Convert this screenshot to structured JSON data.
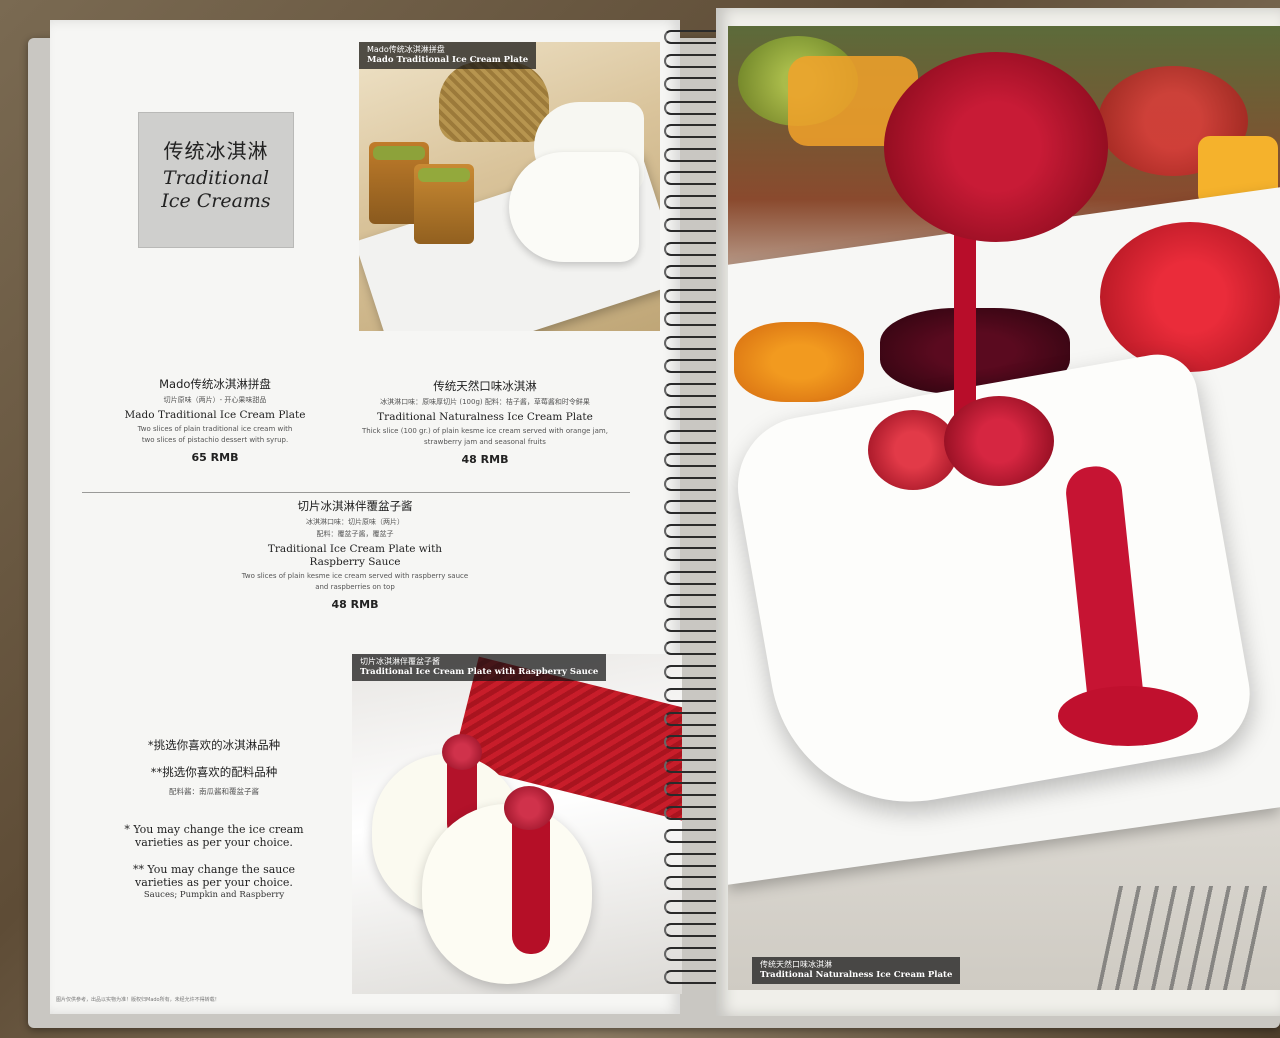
{
  "colors": {
    "title_box_bg": "#cfcfcd",
    "page_bg": "#f6f6f4",
    "caption_bg": "#1a1a1a",
    "raspberry": "#b50f27"
  },
  "section_title": {
    "cn": "传统冰淇淋",
    "en_line1": "Traditional",
    "en_line2": "Ice Creams"
  },
  "photo_top_caption": {
    "cn": "Mado传统冰淇淋拼盘",
    "en": "Mado Traditional Ice Cream Plate"
  },
  "photo_bottom_caption": {
    "cn": "切片冰淇淋伴覆盆子酱",
    "en": "Traditional Ice Cream Plate with Raspberry Sauce"
  },
  "photo_right_caption": {
    "cn": "传统天然口味冰淇淋",
    "en": "Traditional Naturalness Ice Cream Plate"
  },
  "items": [
    {
      "cn": "Mado传统冰淇淋拼盘",
      "sub": "切片原味（两片）- 开心果味甜品",
      "en": "Mado Traditional Ice Cream Plate",
      "desc1": "Two slices of plain traditional ice cream with",
      "desc2": "two slices of pistachio dessert with syrup.",
      "price": "65 RMB"
    },
    {
      "cn": "传统天然口味冰淇淋",
      "sub": "冰淇淋口味：原味厚切片 (100g) 配料：桔子酱，草莓酱和时令鲜果",
      "en": "Traditional Naturalness Ice Cream Plate",
      "desc1": "Thick slice (100 gr.) of plain kesme ice cream served with orange jam,",
      "desc2": "strawberry jam and seasonal fruits",
      "price": "48 RMB"
    },
    {
      "cn": "切片冰淇淋伴覆盆子酱",
      "sub1": "冰淇淋口味：切片原味（两片）",
      "sub2": "配料：覆盆子酱，覆盆子",
      "en_line1": "Traditional Ice Cream Plate with",
      "en_line2": "Raspberry Sauce",
      "desc1": "Two slices of plain kesme ice cream served with raspberry sauce",
      "desc2": "and raspberries on top",
      "price": "48 RMB"
    }
  ],
  "notes": {
    "cn1": "*挑选你喜欢的冰淇淋品种",
    "cn2": "**挑选你喜欢的配料品种",
    "cn3": "配料酱：南瓜酱和覆盆子酱",
    "en1_line1": "* You may change the ice cream",
    "en1_line2": "varieties as per your choice.",
    "en2_line1": "** You may change the sauce",
    "en2_line2": "varieties as per your choice.",
    "en3": "Sauces; Pumpkin and Raspberry"
  },
  "footnote": "图片仅供参考，出品以实物为准！版权归Mado所有，未经允许不得转载！"
}
